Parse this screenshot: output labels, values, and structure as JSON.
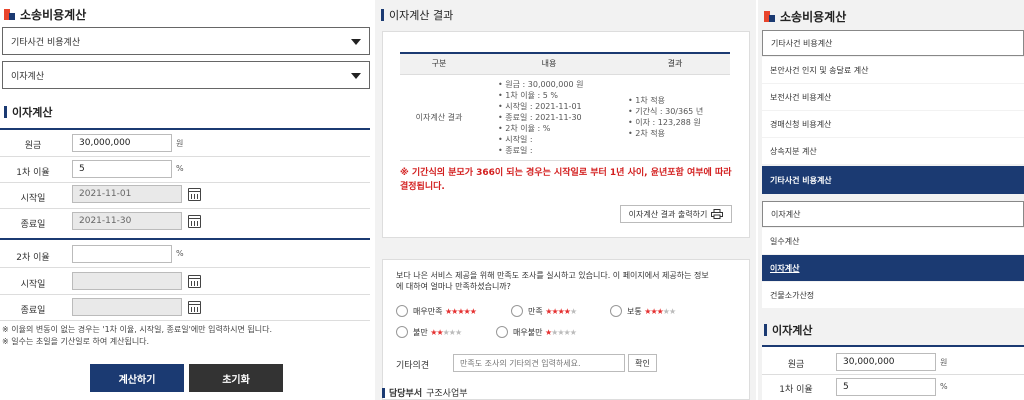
{
  "left": {
    "title": "소송비용계산",
    "select1": "기타사건 비용계산",
    "select2": "이자계산",
    "section_title": "이자계산",
    "rows": {
      "principal_label": "원금",
      "principal_value": "30,000,000",
      "principal_unit": "원",
      "rate1_label": "1차 이율",
      "rate1_value": "5",
      "rate1_unit": "%",
      "start1_label": "시작일",
      "start1_value": "2021-11-01",
      "end1_label": "종료일",
      "end1_value": "2021-11-30",
      "rate2_label": "2차 이율",
      "rate2_value": "",
      "rate2_unit": "%",
      "start2_label": "시작일",
      "start2_value": "",
      "end2_label": "종료일",
      "end2_value": ""
    },
    "notes": [
      "※ 이율의 변동이 없는 경우는 '1차 이율, 시작일, 종료일'에만 입력하시면 됩니다.",
      "※ 일수는 초일을 기산일로 하여 계산됩니다."
    ],
    "calc_button": "계산하기",
    "reset_button": "초기화"
  },
  "middle": {
    "title": "이자계산 결과",
    "table": {
      "headers": [
        "구분",
        "내용",
        "결과"
      ],
      "category": "이자계산 결과",
      "content": [
        "원금 : 30,000,000 원",
        "1차 이율 : 5 %",
        "시작일 : 2021-11-01",
        "종료일 : 2021-11-30",
        "2차 이율 : %",
        "시작일 :",
        "종료일 :"
      ],
      "result": [
        "1차 적용",
        "기간식 : 30/365 년",
        "이자 : 123,288 원",
        "2차 적용"
      ]
    },
    "warning_line1": "※ 기간식의 분모가 366이 되는 경우는 시작일로 부터 1년 사이, 윤년포함 여부에 따라",
    "warning_line2": "결정됩니다.",
    "print_button": "이자계산 결과 출력하기",
    "survey": {
      "question_line1": "보다 나은 서비스 제공을 위해 만족도 조사를 실시하고 있습니다. 이 페이지에서 제공하는 정보",
      "question_line2": "에 대하여 얼마나 만족하셨습니까?",
      "options": [
        "매우만족",
        "만족",
        "보통",
        "불만",
        "매우불만"
      ],
      "ratings": [
        5,
        4,
        3,
        2,
        1
      ],
      "opinion_label": "기타의견",
      "opinion_placeholder": "만족도 조사의 기타의견 입력하세요.",
      "confirm_button": "확인"
    },
    "dept_label": "담당부서",
    "dept_value": "구조사업부"
  },
  "right": {
    "title": "소송비용계산",
    "menu": [
      "기타사건 비용계산",
      "본안사건 인지 및 송달료 계산",
      "보전사건 비용계산",
      "경매신청 비용계산",
      "상속지분 계산",
      "기타사건 비용계산"
    ],
    "submenu": [
      "이자계산",
      "일수계산",
      "이자계산",
      "건물소가산정"
    ],
    "section_title": "이자계산",
    "principal_label": "원금",
    "principal_value": "30,000,000",
    "principal_unit": "원",
    "rate1_label": "1차 이율",
    "rate1_value": "5",
    "rate1_unit": "%"
  },
  "colors": {
    "navy": "#1b3a72",
    "accent_red": "#e8452c",
    "warning_red": "#d32020",
    "dark_button": "#333333"
  }
}
